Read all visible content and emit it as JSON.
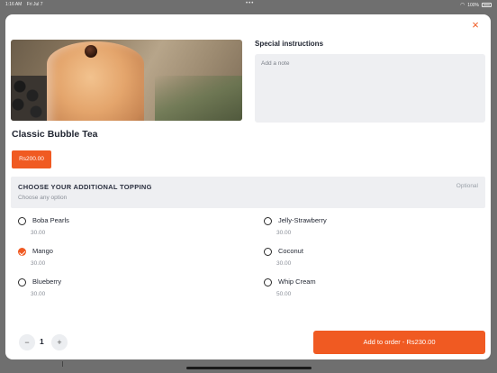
{
  "status_bar": {
    "time": "1:16 AM",
    "date": "Fri Jul 7",
    "battery": "100%"
  },
  "product": {
    "name": "Classic Bubble Tea",
    "price": "Rs200.00",
    "image_alt": "bubble tea glass"
  },
  "instructions": {
    "label": "Special instructions",
    "placeholder": "Add a note"
  },
  "toppings": {
    "title": "CHOOSE YOUR ADDITIONAL TOPPING",
    "subtitle": "Choose any option",
    "optional_label": "Optional",
    "options": [
      {
        "name": "Boba Pearls",
        "price": "30.00",
        "selected": false
      },
      {
        "name": "Jelly-Strawberry",
        "price": "30.00",
        "selected": false
      },
      {
        "name": "Mango",
        "price": "30.00",
        "selected": true
      },
      {
        "name": "Coconut",
        "price": "30.00",
        "selected": false
      },
      {
        "name": "Blueberry",
        "price": "30.00",
        "selected": false
      },
      {
        "name": "Whip Cream",
        "price": "50.00",
        "selected": false
      }
    ]
  },
  "quantity": {
    "value": "1",
    "minus": "−",
    "plus": "+"
  },
  "add_button": {
    "label": "Add to order - Rs230.00"
  },
  "close_icon": "×",
  "colors": {
    "accent": "#f05a22",
    "panel": "#eeeff2"
  }
}
